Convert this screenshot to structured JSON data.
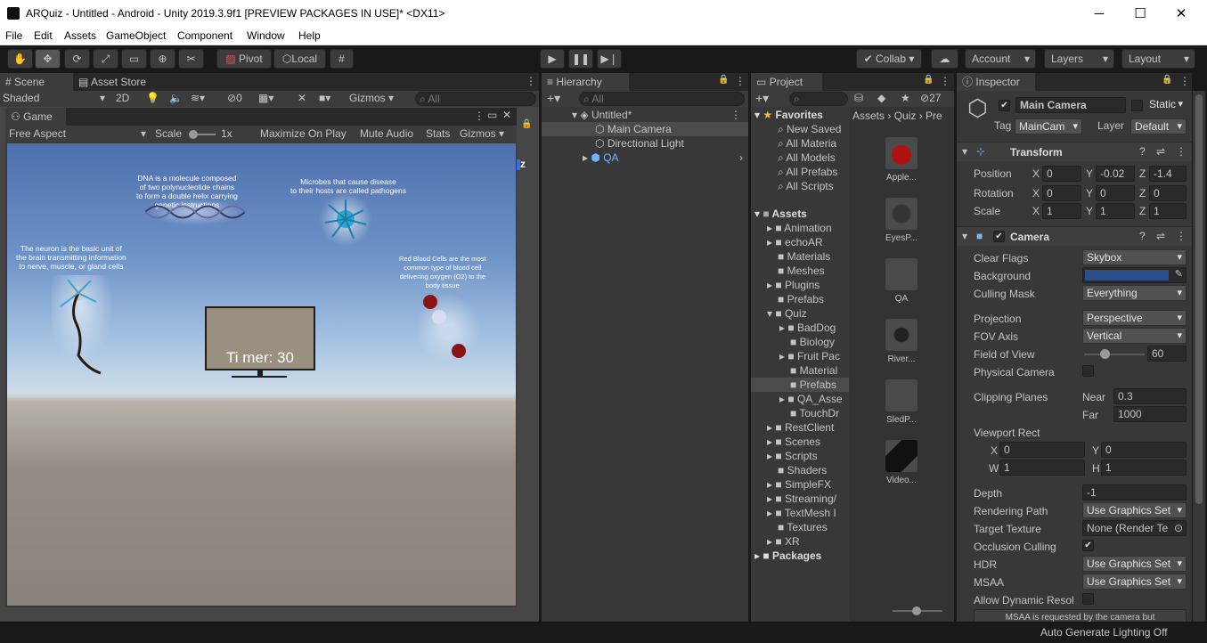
{
  "window": {
    "title": "ARQuiz - Untitled - Android - Unity 2019.3.9f1 [PREVIEW PACKAGES IN USE]* <DX11>",
    "minimize": "─",
    "maximize": "☐",
    "close": "✕"
  },
  "menu": [
    "File",
    "Edit",
    "Assets",
    "GameObject",
    "Component",
    "Window",
    "Help"
  ],
  "toolbar": {
    "pivot": "Pivot",
    "local": "Local",
    "collab": "Collab",
    "account": "Account",
    "layers": "Layers",
    "layout": "Layout"
  },
  "scene": {
    "tabs": [
      "Scene",
      "Asset Store"
    ],
    "shading": "Shaded",
    "mode2d": "2D",
    "hidden_count": "0",
    "gizmos": "Gizmos",
    "search_placeholder": "All"
  },
  "game": {
    "tab": "Game",
    "aspect": "Free Aspect",
    "scale_label": "Scale",
    "scale_value": "1x",
    "maximize": "Maximize On Play",
    "mute": "Mute Audio",
    "stats": "Stats",
    "gizmos": "Gizmos",
    "captions": {
      "dna": "DNA is a molecule composed\nof two polynucleotide chains\nto form a double helix carrying\ngenetic instructions",
      "microbes": "Microbes that cause disease\nto their hosts are called pathogens",
      "neuron": "The neuron is the basic unit of\nthe brain transmitting information\nto nerve, muscle, or gland cells",
      "blood": "Red Blood Cells are the most\ncommon type of blood cell\ndelivering oxygen (O2) to the\nbody tissue"
    },
    "timer": "Ti mer: 30",
    "axis_label": "z"
  },
  "hierarchy": {
    "tab": "Hierarchy",
    "search_placeholder": "All",
    "scene": "Untitled*",
    "items": [
      "Main Camera",
      "Directional Light",
      "QA"
    ]
  },
  "project": {
    "tab": "Project",
    "hidden_count": "27",
    "favorites": {
      "label": "Favorites",
      "items": [
        "New Saved",
        "All Materia",
        "All Models",
        "All Prefabs",
        "All Scripts"
      ]
    },
    "assets_label": "Assets",
    "folders": [
      "Animation",
      "echoAR",
      "Materials",
      "Meshes",
      "Plugins",
      "Prefabs",
      "Quiz",
      "BadDog",
      "Biology",
      "Fruit Pac",
      "Material",
      "Prefabs",
      "QA_Asse",
      "TouchDr",
      "RestClient",
      "Scenes",
      "Scripts",
      "Shaders",
      "SimpleFX",
      "Streaming/",
      "TextMesh I",
      "Textures",
      "XR"
    ],
    "packages_label": "Packages",
    "breadcrumb": [
      "Assets",
      "Quiz",
      "Pre"
    ],
    "thumbs": [
      "Apple...",
      "EyesP...",
      "QA",
      "River...",
      "SledP...",
      "Video..."
    ]
  },
  "inspector": {
    "tab": "Inspector",
    "name": "Main Camera",
    "static": "Static",
    "tag_label": "Tag",
    "tag": "MainCam",
    "layer_label": "Layer",
    "layer": "Default",
    "transform": {
      "title": "Transform",
      "rows": [
        {
          "label": "Position",
          "x": "0",
          "y": "-0.02",
          "z": "-1.4"
        },
        {
          "label": "Rotation",
          "x": "0",
          "y": "0",
          "z": "0"
        },
        {
          "label": "Scale",
          "x": "1",
          "y": "1",
          "z": "1"
        }
      ]
    },
    "camera": {
      "title": "Camera",
      "clear_flags_label": "Clear Flags",
      "clear_flags": "Skybox",
      "background_label": "Background",
      "background_color": "#2a4e86",
      "culling_label": "Culling Mask",
      "culling": "Everything",
      "projection_label": "Projection",
      "projection": "Perspective",
      "fov_axis_label": "FOV Axis",
      "fov_axis": "Vertical",
      "fov_label": "Field of View",
      "fov": "60",
      "physical_label": "Physical Camera",
      "clipping_label": "Clipping Planes",
      "near_label": "Near",
      "near": "0.3",
      "far_label": "Far",
      "far": "1000",
      "viewport_label": "Viewport Rect",
      "vx": "0",
      "vy": "0",
      "vw": "1",
      "vh": "1",
      "depth_label": "Depth",
      "depth": "-1",
      "rendering_label": "Rendering Path",
      "rendering": "Use Graphics Set",
      "target_label": "Target Texture",
      "target": "None (Render Te",
      "occlusion_label": "Occlusion Culling",
      "hdr_label": "HDR",
      "hdr": "Use Graphics Set",
      "msaa_label": "MSAA",
      "msaa": "Use Graphics Set",
      "dynres_label": "Allow Dynamic Resol",
      "note": "MSAA is requested by the camera but"
    }
  },
  "status": "Auto Generate Lighting Off"
}
